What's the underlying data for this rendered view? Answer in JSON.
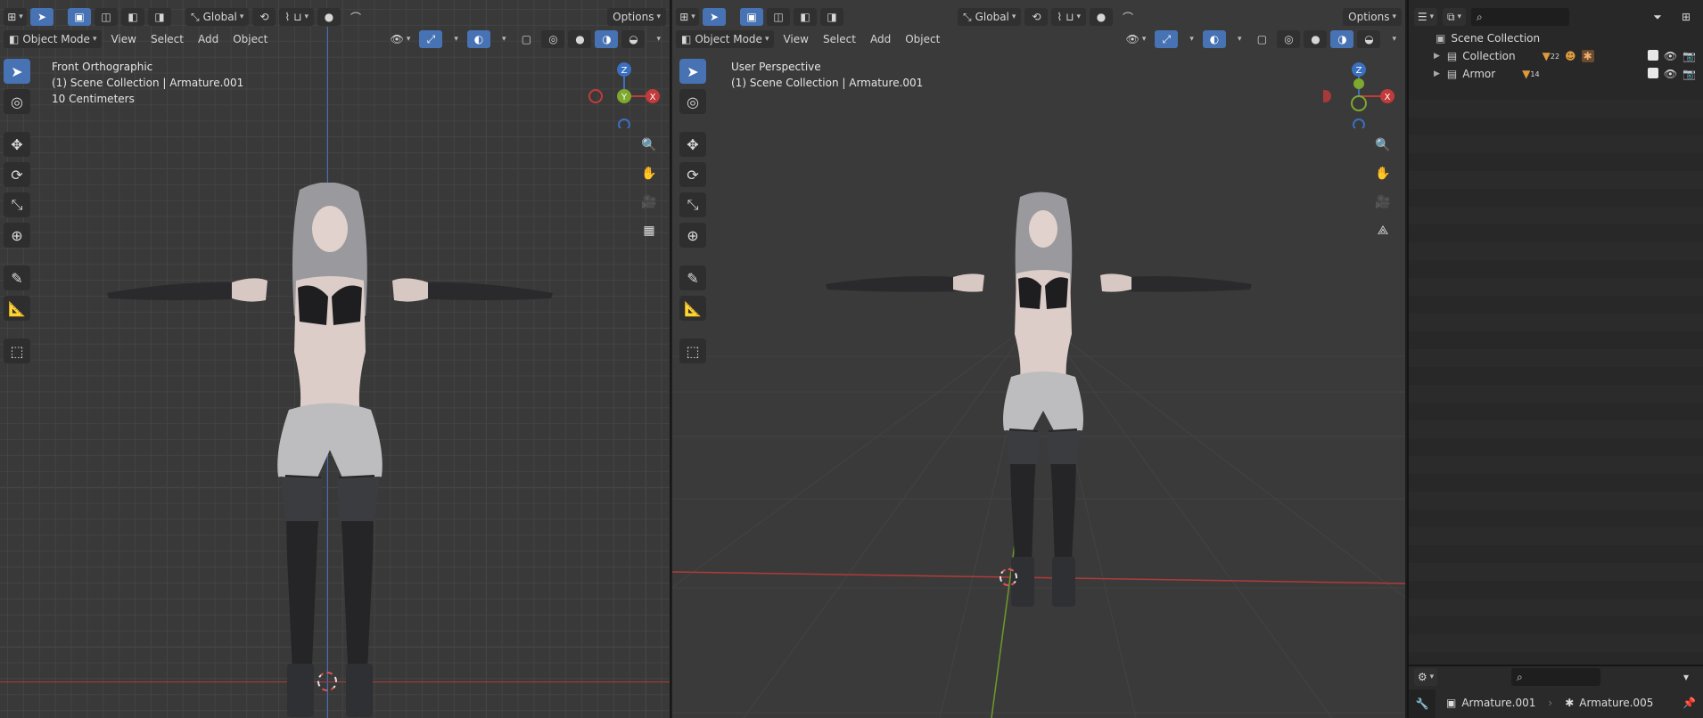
{
  "left_viewport": {
    "header_top": {
      "transform_orientation": "Global",
      "options_label": "Options"
    },
    "header_menu": {
      "mode": "Object Mode",
      "menus": [
        "View",
        "Select",
        "Add",
        "Object"
      ]
    },
    "overlay": {
      "view_name": "Front Orthographic",
      "collection_info": "(1) Scene Collection | Armature.001",
      "grid_scale": "10 Centimeters"
    },
    "gizmo": {
      "z": "Z",
      "y": "Y",
      "x": "X"
    }
  },
  "right_viewport": {
    "header_top": {
      "transform_orientation": "Global",
      "options_label": "Options"
    },
    "header_menu": {
      "mode": "Object Mode",
      "menus": [
        "View",
        "Select",
        "Add",
        "Object"
      ]
    },
    "overlay": {
      "view_name": "User Perspective",
      "collection_info": "(1) Scene Collection | Armature.001"
    },
    "gizmo": {
      "z": "Z",
      "x": "X"
    }
  },
  "outliner": {
    "root": "Scene Collection",
    "items": [
      {
        "label": "Collection",
        "badge": "22"
      },
      {
        "label": "Armor",
        "badge": "14"
      }
    ],
    "properties": {
      "active_object": "Armature.001",
      "active_data": "Armature.005"
    }
  },
  "colors": {
    "accent": "#4772b3",
    "axis_x": "#c23b3b",
    "axis_y": "#7ea82e",
    "axis_z": "#3b6fbf"
  }
}
